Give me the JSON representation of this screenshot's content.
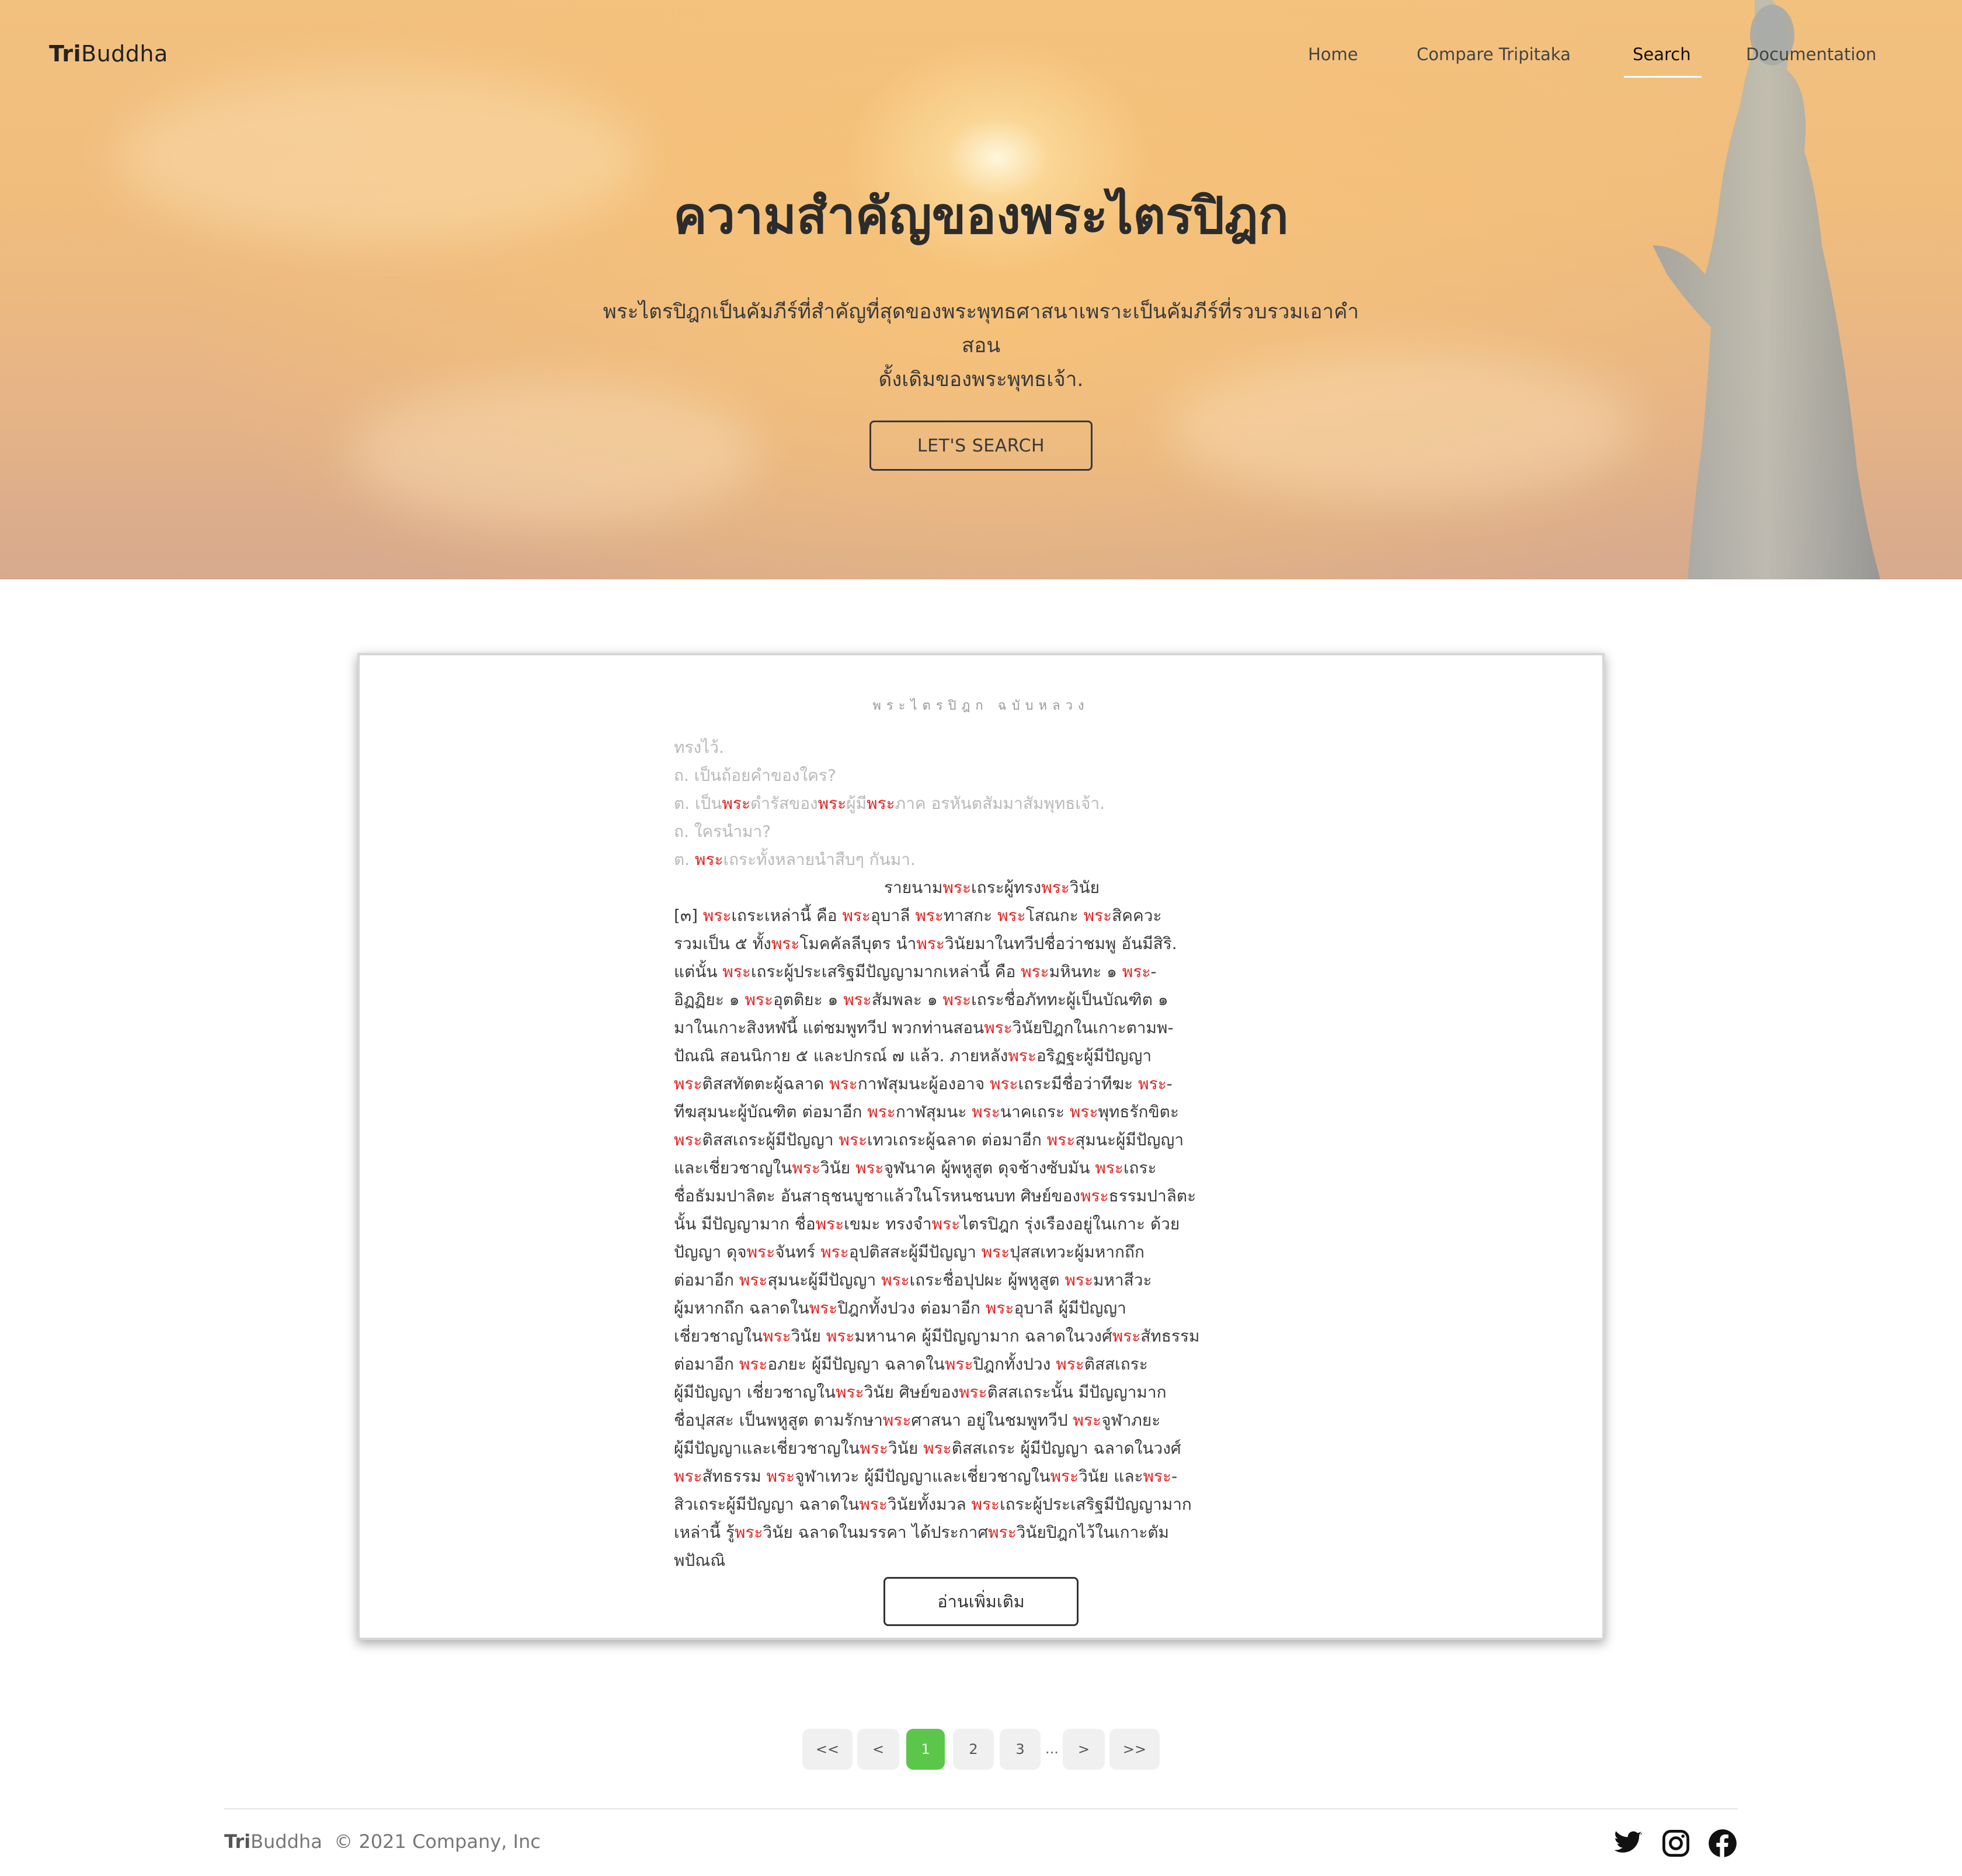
{
  "brand": {
    "bold": "Tri",
    "rest": "Buddha"
  },
  "nav": [
    {
      "label": "Home",
      "active": false
    },
    {
      "label": "Compare Tripitaka",
      "active": false
    },
    {
      "label": "Search",
      "active": true
    },
    {
      "label": "Documentation",
      "active": false
    }
  ],
  "hero": {
    "title": "ความสำคัญของพระไตรปิฎก",
    "subtitle_line1": "พระไตรปิฎกเป็นคัมภีร์ที่สำคัญที่สุดของพระพุทธศาสนาเพราะเป็นคัมภีร์ที่รวบรวมเอาคำสอน",
    "subtitle_line2": "ดั้งเดิมของพระพุทธเจ้า.",
    "button": "LET'S SEARCH"
  },
  "result": {
    "heading": "พระไตรปิฎก ฉบับหลวง",
    "highlight_term": "พระ",
    "faded_lines": [
      "ทรงไว้.",
      "ถ. เป็นถ้อยคำของใคร?",
      "ต. เป็นพระดำรัสของพระผู้มีพระภาค อรหันตสัมมาสัมพุทธเจ้า.",
      "ถ. ใครนำมา?",
      "ต. พระเถระทั้งหลายนำสืบๆ กันมา."
    ],
    "center_line": "รายนามพระเถระผู้ทรงพระวินัย",
    "lines": [
      "[๓] พระเถระเหล่านี้ คือ พระอุบาลี พระทาสกะ พระโสณกะ พระสิคควะ",
      "รวมเป็น ๕ ทั้งพระโมคคัลลีบุตร นำพระวินัยมาในทวีปชื่อว่าชมพู อันมีสิริ.",
      "แต่นั้น พระเถระผู้ประเสริฐมีปัญญามากเหล่านี้ คือ พระมหินทะ ๑ พระ-",
      "อิฏฏิยะ ๑ พระอุตติยะ ๑ พระสัมพละ ๑ พระเถระชื่อภัททะผู้เป็นบัณฑิต ๑",
      "มาในเกาะสิงหฬนี้ แต่ชมพูทวีป พวกท่านสอนพระวินัยปิฎกในเกาะตามพ-",
      "ปัณณิ สอนนิกาย ๕ และปกรณ์ ๗ แล้ว. ภายหลังพระอริฏฐะผู้มีปัญญา",
      "พระติสสทัตตะผู้ฉลาด พระกาฬสุมนะผู้องอาจ พระเถระมีชื่อว่าทีฆะ พระ-",
      "ทีฆสุมนะผู้บัณฑิต ต่อมาอีก พระกาฬสุมนะ พระนาคเถระ พระพุทธรักขิตะ",
      "พระติสสเถระผู้มีปัญญา พระเทวเถระผู้ฉลาด ต่อมาอีก พระสุมนะผู้มีปัญญา",
      "และเชี่ยวชาญในพระวินัย พระจูฬนาค ผู้พหูสูต ดุจช้างซับมัน พระเถระ",
      "ชื่อธัมมปาลิตะ อันสาธุชนบูชาแล้วในโรหนชนบท ศิษย์ของพระธรรมปาลิตะ",
      "นั้น มีปัญญามาก ชื่อพระเขมะ ทรงจำพระไตรปิฎก รุ่งเรืองอยู่ในเกาะ ด้วย",
      "ปัญญา ดุจพระจันทร์ พระอุปติสสะผู้มีปัญญา พระปุสสเทวะผู้มหากถึก",
      "ต่อมาอีก พระสุมนะผู้มีปัญญา พระเถระชื่อปุปผะ ผู้พหูสูต พระมหาสีวะ",
      "ผู้มหากถึก ฉลาดในพระปิฎกทั้งปวง ต่อมาอีก พระอุบาลี ผู้มีปัญญา",
      "เชี่ยวชาญในพระวินัย พระมหานาค ผู้มีปัญญามาก ฉลาดในวงศ์พระสัทธรรม",
      "ต่อมาอีก พระอภยะ ผู้มีปัญญา ฉลาดในพระปิฎกทั้งปวง พระติสสเถระ",
      "ผู้มีปัญญา เชี่ยวชาญในพระวินัย ศิษย์ของพระติสสเถระนั้น มีปัญญามาก",
      "ชื่อปุสสะ เป็นพหูสูต ตามรักษาพระศาสนา อยู่ในชมพูทวีป พระจูฬาภยะ",
      "ผู้มีปัญญาและเชี่ยวชาญในพระวินัย พระติสสเถระ ผู้มีปัญญา ฉลาดในวงศ์",
      "พระสัทธรรม พระจูฬาเทวะ ผู้มีปัญญาและเชี่ยวชาญในพระวินัย และพระ-",
      "สิวเถระผู้มีปัญญา ฉลาดในพระวินัยทั้งมวล พระเถระผู้ประเสริฐมีปัญญามาก",
      "เหล่านี้ รู้พระวินัย ฉลาดในมรรคา ได้ประกาศพระวินัยปิฎกไว้ในเกาะตัม",
      "พปัณณิ"
    ],
    "more_button": "อ่านเพิ่มเติม"
  },
  "pagination": {
    "first": "<<",
    "prev": "<",
    "pages": [
      "1",
      "2",
      "3"
    ],
    "active": "1",
    "ellipsis": "...",
    "next": ">",
    "last": ">>"
  },
  "footer": {
    "brand_bold": "Tri",
    "brand_rest": "Buddha",
    "copyright": "© 2021 Company, Inc",
    "social": [
      "twitter-icon",
      "instagram-icon",
      "facebook-icon"
    ]
  },
  "colors": {
    "highlight": "#e02424",
    "active_page": "#5cc64a",
    "hero_sky": "#f0bd7d"
  }
}
